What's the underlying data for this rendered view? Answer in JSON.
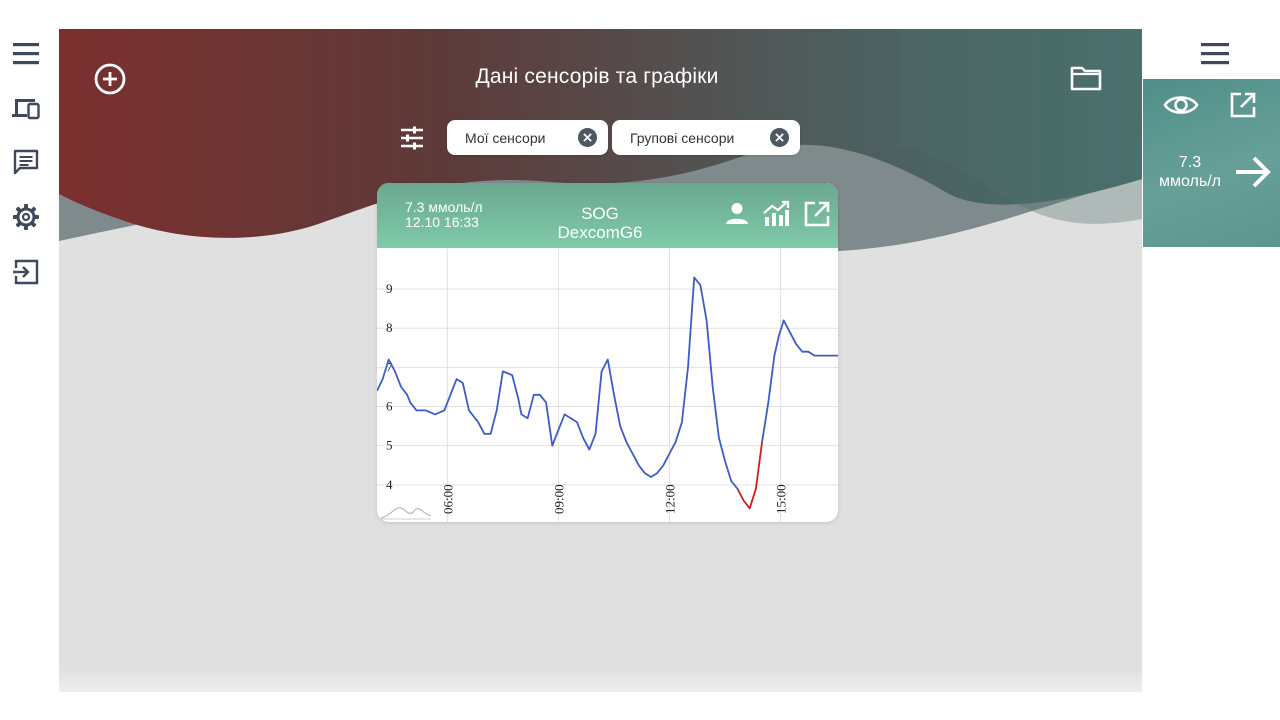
{
  "header": {
    "title": "Дані сенсорів та графіки"
  },
  "filters": {
    "chips": [
      {
        "label": "Мої сенсори"
      },
      {
        "label": "Групові сенсори"
      }
    ]
  },
  "left_rail": {
    "icons": [
      "menu-icon",
      "devices-icon",
      "message-icon",
      "settings-gear-icon",
      "sign-in-icon"
    ]
  },
  "sensor_card": {
    "value": "7.3 ммоль/л",
    "datetime": "12.10 16:33",
    "name_line1": "SOG",
    "name_line2": "DexcomG6",
    "icons": [
      "person-icon",
      "chart-trend-icon",
      "open-external-icon"
    ],
    "colors": {
      "header": "#7bc6a6",
      "line": "#3d5ccc",
      "low_line": "#d41c1c"
    }
  },
  "right_panel": {
    "value_number": "7.3",
    "value_unit": "ммоль/л",
    "icons": [
      "menu-icon",
      "eye-icon",
      "open-external-icon",
      "arrow-right-icon"
    ]
  },
  "chart_data": {
    "type": "line",
    "y_ticks": [
      4,
      5,
      6,
      7,
      8,
      9
    ],
    "x_tick_labels": [
      "06:00",
      "09:00",
      "12:00",
      "15:00"
    ],
    "x_range": [
      "04:06",
      "16:33"
    ],
    "ylim": [
      3.05,
      10.05
    ],
    "grid": true,
    "series": [
      {
        "x": [
          "04:06",
          "04:15",
          "04:25",
          "04:35",
          "04:45",
          "04:55",
          "05:00",
          "05:10",
          "05:25",
          "05:40",
          "05:55",
          "06:00",
          "06:15",
          "06:25",
          "06:35",
          "06:50",
          "07:00",
          "07:10",
          "07:20",
          "07:30",
          "07:45",
          "07:55",
          "08:00",
          "08:10",
          "08:20",
          "08:30",
          "08:40",
          "08:50",
          "09:00",
          "09:10",
          "09:20",
          "09:30",
          "09:40",
          "09:50",
          "10:00",
          "10:10",
          "10:20",
          "10:30",
          "10:40",
          "10:50",
          "11:00",
          "11:10",
          "11:20",
          "11:30",
          "11:40",
          "11:50",
          "12:00",
          "12:10",
          "12:20",
          "12:30",
          "12:40",
          "12:50",
          "13:00",
          "13:10",
          "13:20",
          "13:30",
          "13:40",
          "13:50",
          "14:00",
          "14:10",
          "14:20",
          "14:30",
          "14:40",
          "14:50",
          "14:57",
          "15:05",
          "15:15",
          "15:25",
          "15:35",
          "15:45",
          "15:55",
          "16:05",
          "16:15",
          "16:25",
          "16:33"
        ],
        "y": [
          6.4,
          6.7,
          7.2,
          6.9,
          6.5,
          6.3,
          6.1,
          5.9,
          5.9,
          5.8,
          5.9,
          6.1,
          6.7,
          6.6,
          5.9,
          5.6,
          5.3,
          5.3,
          5.9,
          6.9,
          6.8,
          6.2,
          5.8,
          5.7,
          6.3,
          6.3,
          6.1,
          5.0,
          5.4,
          5.8,
          5.7,
          5.6,
          5.2,
          4.9,
          5.3,
          6.9,
          7.2,
          6.3,
          5.5,
          5.1,
          4.8,
          4.5,
          4.3,
          4.2,
          4.3,
          4.5,
          4.8,
          5.1,
          5.6,
          7.0,
          9.3,
          9.1,
          8.2,
          6.5,
          5.2,
          4.6,
          4.1,
          3.9,
          3.6,
          3.4,
          3.9,
          5.1,
          6.1,
          7.3,
          7.8,
          8.2,
          7.9,
          7.6,
          7.4,
          7.4,
          7.3,
          7.3,
          7.3,
          7.3,
          7.3
        ]
      }
    ]
  }
}
